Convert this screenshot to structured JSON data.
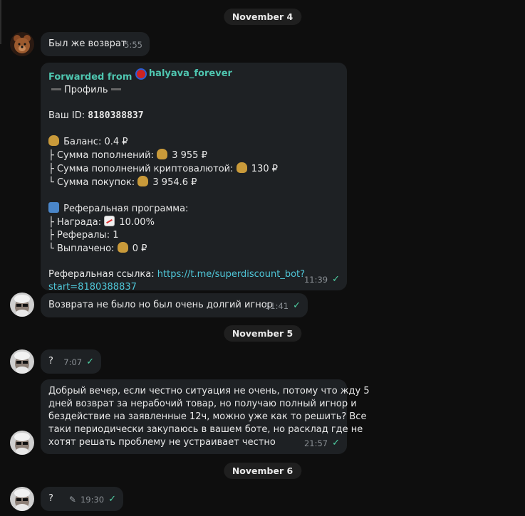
{
  "dates": [
    "November 4",
    "November 5",
    "November 6"
  ],
  "messages": {
    "m1": {
      "text": "Был же возврат",
      "time": "5:55"
    },
    "fwd": {
      "header_prefix": "Forwarded from",
      "username": "halyava_forever",
      "profile_title": "Профиль",
      "id_label": "Ваш ID: ",
      "id_value": "8180388837",
      "balance": "Баланс: 0.4 ₽",
      "deposits_label": "├ Сумма пополнений: ",
      "deposits_value": "3 955 ₽",
      "crypto_label": "├ Сумма пополнений криптовалютой: ",
      "crypto_value": "130 ₽",
      "purchases_label": "└ Сумма покупок: ",
      "purchases_value": "3 954.6 ₽",
      "referral_title": "Реферальная программа:",
      "reward_label": "├ Награда: ",
      "reward_value": "10.00%",
      "referrals": "├ Рефералы: 1",
      "paid_label": "└ Выплачено: ",
      "paid_value": "0 ₽",
      "link_label": "Реферальная ссылка: ",
      "link_line1": "https://t.me/superdiscount_bot?",
      "link_line2": "start=8180388837",
      "time": "11:39"
    },
    "m3": {
      "text": "Возврата не было но был очень долгий игнор",
      "time": "11:41"
    },
    "m4": {
      "text": "?",
      "time": "7:07"
    },
    "m5": {
      "lines": [
        "Добрый вечер, если честно ситуация не очень, потому что жду 5",
        "дней возврат за нерабочий товар, но получаю полный игнор и",
        "бездействие на заявленные 12ч, можно уже как то решить? Все",
        "таки периодически закупаюсь в вашем боте, но расклад где не",
        "хотят решать проблему не устраивает честно"
      ],
      "time": "21:57"
    },
    "m6": {
      "text": "?",
      "time": "19:30"
    }
  },
  "icons": {
    "read_check": "double-check-icon",
    "edited": "pencil-icon",
    "money_bag": "money-bag-icon",
    "chart": "chart-increasing-icon",
    "people": "people-icon"
  },
  "colors": {
    "background": "#0e0e0e",
    "bubble": "#1e2124",
    "accent": "#4fc6b0",
    "check": "#4fd0a4",
    "date_pill": "#1f1f1f"
  }
}
